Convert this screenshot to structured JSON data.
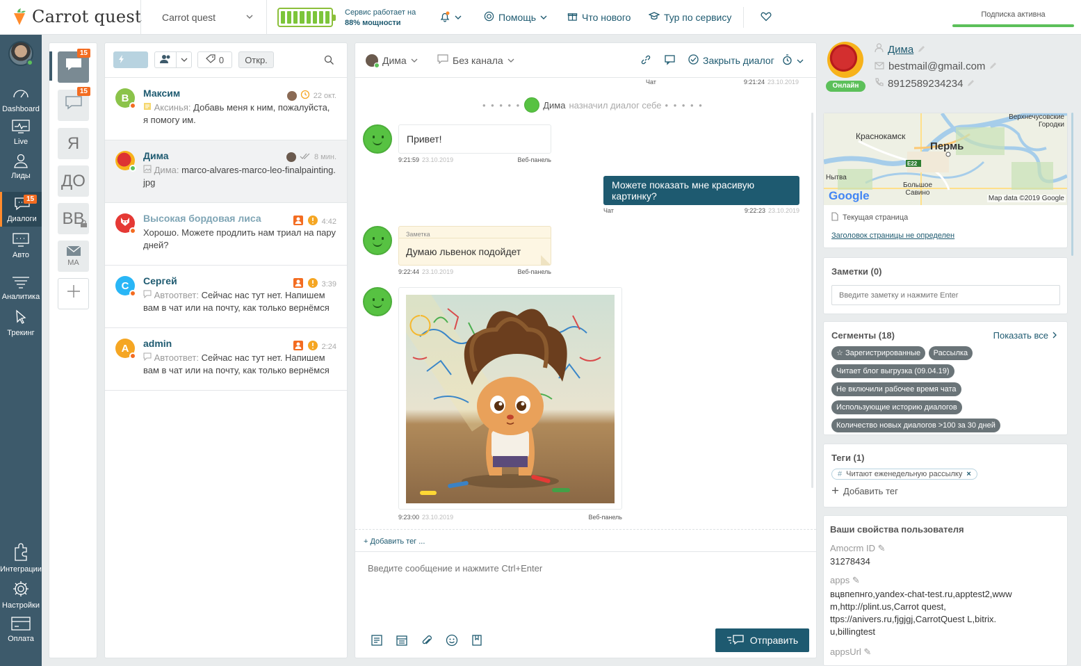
{
  "header": {
    "logo": "Carrot quest",
    "project": "Carrot quest",
    "service_status_line1": "Сервис работает на",
    "service_status_line2": "88% мощности",
    "battery_level": 0.88,
    "help": "Помощь",
    "whats_new": "Что нового",
    "tour": "Тур по сервису",
    "subscription": "Подписка активна"
  },
  "nav": {
    "items": [
      "Dashboard",
      "Live",
      "Лиды",
      "Диалоги",
      "Авто",
      "Аналитика",
      "Трекинг",
      "Интеграции",
      "Настройки",
      "Оплата"
    ],
    "dialogs_badge": "15"
  },
  "folders": {
    "badge1": "15",
    "badge2": "15",
    "items": [
      "Я",
      "ДО",
      "ВВ",
      "MA"
    ]
  },
  "list": {
    "tag_count": "0",
    "status_filter": "Откр.",
    "conversations": [
      {
        "initial": "В",
        "name": "Максим",
        "time": "22 окт.",
        "who": "Аксинья:",
        "text": "Добавь меня к ним, пожалуйста, я помогу им."
      },
      {
        "initial": "",
        "name": "Дима",
        "time": "8 мин.",
        "who": "Дима:",
        "text": "marco-alvares-marco-leo-finalpainting.jpg"
      },
      {
        "initial": "",
        "name": "Высокая бордовая лиса",
        "time": "4:42",
        "who": "",
        "text": "Хорошо. Можете продлить нам триал на пару дней?"
      },
      {
        "initial": "С",
        "name": "Сергей",
        "time": "3:39",
        "who": "Автоответ:",
        "text": "Сейчас нас тут нет. Напишем вам в чат или на почту, как только вернёмся"
      },
      {
        "initial": "A",
        "name": "admin",
        "time": "2:24",
        "who": "Автоответ:",
        "text": "Сейчас нас тут нет. Напишем вам в чат или на почту, как только вернёмся"
      }
    ]
  },
  "chat": {
    "user": "Дима",
    "channel": "Без канала",
    "close": "Закрыть диалог",
    "top_meta_left": "Чат",
    "top_meta_time": "9:21:24",
    "top_meta_date": "23.10.2019",
    "assign_name": "Дима",
    "assign_text": "назначил диалог себе",
    "messages": {
      "m1": {
        "text": "Привет!",
        "time": "9:21:59",
        "date": "23.10.2019",
        "src": "Веб-панель"
      },
      "m2": {
        "text": "Можете показать мне красивую картинку?",
        "src": "Чат",
        "time": "9:22:23",
        "date": "23.10.2019"
      },
      "m3": {
        "label": "Заметка",
        "text": "Думаю львенок подойдет",
        "time": "9:22:44",
        "date": "23.10.2019",
        "src": "Веб-панель"
      },
      "m4": {
        "time": "9:23:00",
        "date": "23.10.2019",
        "src": "Веб-панель"
      }
    },
    "add_tag": "+ Добавить тег ...",
    "input_placeholder": "Введите сообщение и нажмите Ctrl+Enter",
    "send": "Отправить"
  },
  "user": {
    "name": "Дима",
    "status": "Онлайн",
    "email": "bestmail@gmail.com",
    "phone": "8912589234234",
    "map": {
      "city1": "Краснокамск",
      "city2": "Пермь",
      "city3": "Верхнечусовские Городки",
      "city4": "Нытва",
      "city5": "Большое Савино",
      "road": "E22",
      "brand": "Google",
      "credit": "Map data ©2019 Google"
    },
    "current_page": "Текущая страница",
    "page_title": "Заголовок страницы не определен",
    "notes_title": "Заметки (0)",
    "notes_placeholder": "Введите заметку и нажмите Enter",
    "segments_title": "Сегменты (18)",
    "show_all": "Показать все",
    "segments": [
      "Зарегистрированные",
      "Рассылка",
      "Читает блог выгрузка (09.04.19)",
      "Не включили рабочее время чата",
      "Использующие историю диалогов",
      "Количество новых диалогов >100 за 30 дней"
    ],
    "tags_title": "Теги (1)",
    "tag": "Читают еженедельную рассылку",
    "add_tag": "Добавить тег",
    "props_title": "Ваши свойства пользователя",
    "amocrm_label": "Amocrm ID",
    "amocrm_value": "31278434",
    "apps_label": "apps",
    "apps_value": "вцвпепнго,yandex-chat-test.ru,apptest2,wwwm,http://plint.us,Carrot quest,ttps://anivers.ru,fjgjgj,CarrotQuest L,bitrix.u,billingtest",
    "apps_lines": [
      "вцвпепнго,yandex-chat-test.ru,apptest2,www",
      "m,http://plint.us,Carrot quest,",
      "ttps://anivers.ru,fjgjgj,CarrotQuest L,bitrix.",
      "u,billingtest"
    ],
    "appsurl_label": "appsUrl"
  },
  "colors": {
    "brand_dark": "#1e5a70",
    "accent": "#ff8b2c",
    "nav": "#3d5a6b",
    "online": "#5cc05a"
  }
}
